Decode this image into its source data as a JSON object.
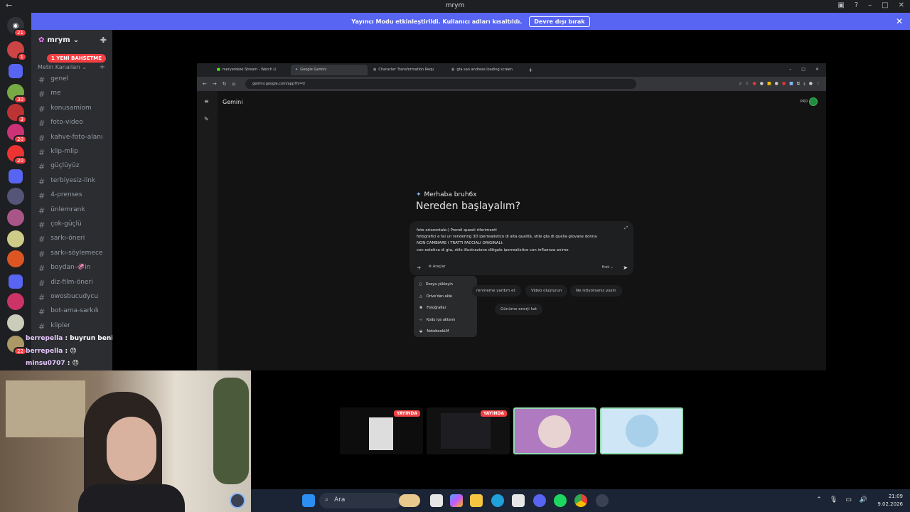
{
  "window": {
    "title": "mrym"
  },
  "notice": {
    "text": "Yayıncı Modu etkinleştirildi. Kullanıcı adları kısaltıldı.",
    "button": "Devre dışı bırak"
  },
  "server": {
    "name": "mrym",
    "new_messages": "1 YENİ BAHSETME"
  },
  "rail_badges": [
    "21",
    "1",
    "30",
    "3",
    "20",
    "20",
    "22"
  ],
  "category": "Metin Kanalları",
  "channels": [
    "genel",
    "me",
    "konusamiom",
    "foto-video",
    "kahve-foto-alanı",
    "klip-mlip",
    "güçlüyüz",
    "terbiyesiz-link",
    "4-prenses",
    "ünlemrank",
    "çok-güçlü",
    "sarkı-öneri",
    "sarkı-söylemece",
    "boydan-🦑in",
    "diz-film-öneri",
    "owosbucudycu",
    "bot-ama-sarkılı",
    "klipler"
  ],
  "chat": [
    {
      "user": "berrepella",
      "text": ": buyrun benim"
    },
    {
      "user": "berrepella",
      "text": ": 😞"
    },
    {
      "user": "minsu0707",
      "text": ": 😞"
    }
  ],
  "browser": {
    "tabs": [
      "meryemkee Stream - Watch Li",
      "Google Gemini",
      "Character Transformation Requ",
      "gta san andreas loading screen"
    ],
    "url": "gemini.google.com/app?hl=tr",
    "app_title": "Gemini",
    "plan": "PRO",
    "greeting": "Merhaba bruh6x",
    "heading": "Nereden başlayalım?",
    "prompt_lines": [
      "foto orizzontale:) Prendi questi riferimenti",
      "fotografici e fai un rendering 3D iperrealistico di alta qualità, stile gta di quella giovane donna",
      "NON CAMBIARE I TRATTI FACCIALI ORIGINALI:",
      "con estetica di gta, stile illustrazione ditigale iperrealistico con influenza anime"
    ],
    "tools_label": "Araçlar",
    "speed_label": "Hızlı",
    "menu": [
      "Dosya yükleyin",
      "Drive'dan ekle",
      "Fotoğraflar",
      "Kodu içe aktarın",
      "NotebookLM"
    ],
    "chips": [
      "renmeme yardım et",
      "Video oluşturun",
      "Ne istiyorsanız yazın",
      "Günüme enerji kat"
    ]
  },
  "streams": {
    "live_label": "YAYINDA"
  },
  "taskbar": {
    "search": "Ara",
    "time": "21:09",
    "date": "9.02.2026"
  }
}
